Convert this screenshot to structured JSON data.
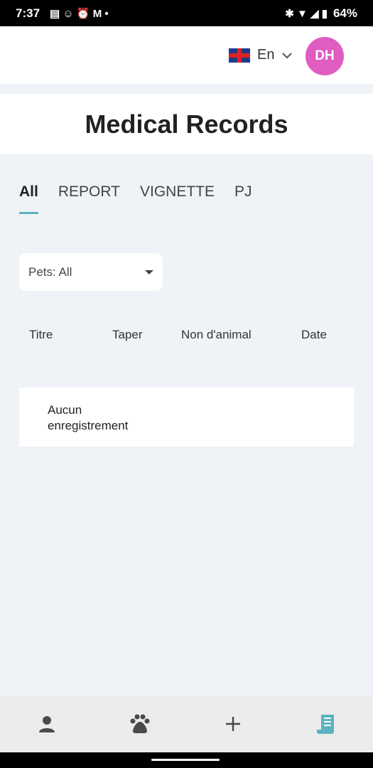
{
  "status": {
    "time": "7:37",
    "battery": "64%"
  },
  "header": {
    "language": "En",
    "avatar_initials": "DH"
  },
  "page_title": "Medical Records",
  "tabs": [
    {
      "label": "All",
      "active": true
    },
    {
      "label": "REPORT"
    },
    {
      "label": "VIGNETTE"
    },
    {
      "label": "PJ"
    }
  ],
  "filter": {
    "value": "Pets: All"
  },
  "table": {
    "columns": [
      "Titre",
      "Taper",
      "Non d'animal",
      "Date"
    ],
    "empty_message": "Aucun enregistrement"
  },
  "bottom_nav": [
    {
      "icon": "person-icon"
    },
    {
      "icon": "paw-icon"
    },
    {
      "icon": "plus-icon"
    },
    {
      "icon": "records-icon",
      "active": true
    }
  ],
  "colors": {
    "accent": "#5ab3c0",
    "avatar": "#e05cc0"
  }
}
